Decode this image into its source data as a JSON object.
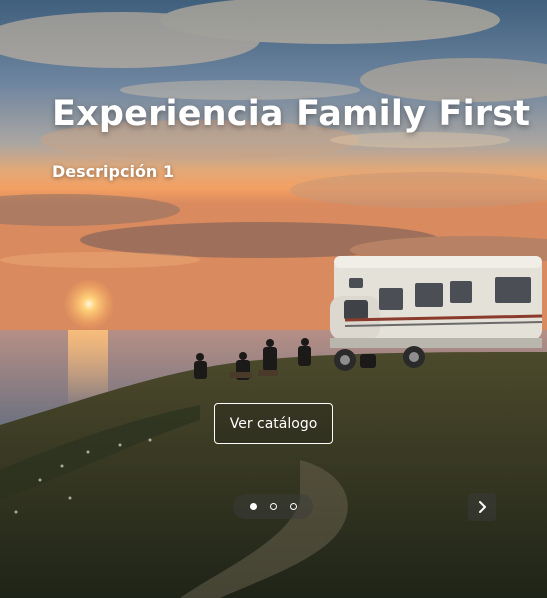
{
  "hero": {
    "title": "Experiencia Family First",
    "description": "Descripción 1",
    "cta_label": "Ver catálogo"
  },
  "carousel": {
    "slide_count": 3,
    "active_index": 0,
    "next_icon": "chevron-right-icon"
  },
  "colors": {
    "text": "#ffffff",
    "sky_top": "#4f6f8a",
    "sunset": "#f0a060",
    "grass": "#3a3f27"
  }
}
